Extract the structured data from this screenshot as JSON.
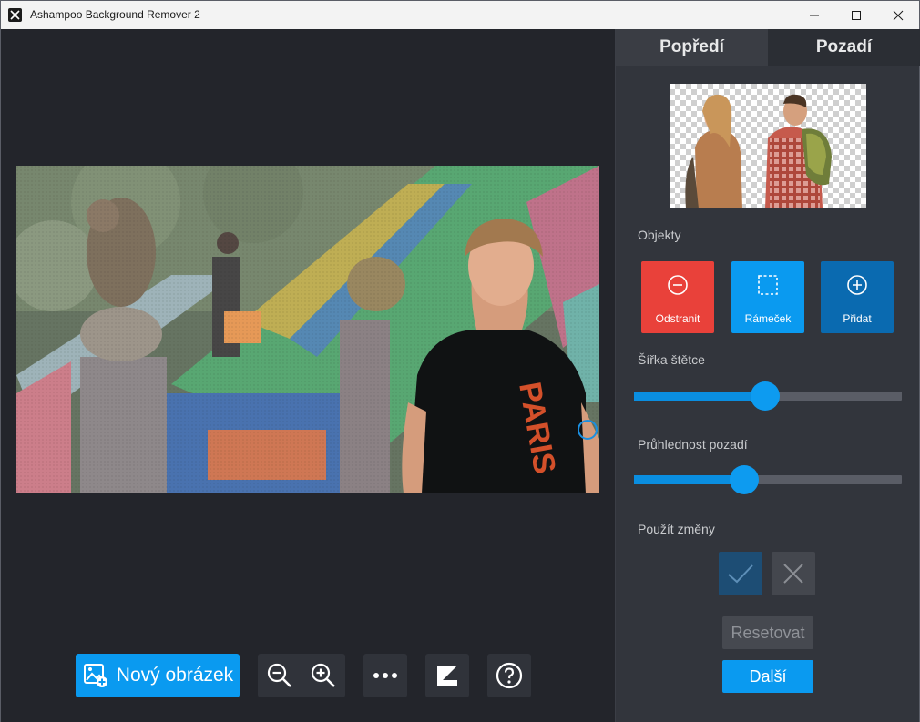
{
  "window": {
    "title": "Ashampoo Background Remover 2"
  },
  "toolbar": {
    "new_image_label": "Nový obrázek"
  },
  "panel": {
    "tabs": [
      {
        "label": "Popředí",
        "active": true
      },
      {
        "label": "Pozadí",
        "active": false
      }
    ],
    "objects_label": "Objekty",
    "object_buttons": [
      {
        "label": "Odstranit",
        "color": "#e9413a"
      },
      {
        "label": "Rámeček",
        "color": "#0a9af0"
      },
      {
        "label": "Přidat",
        "color": "#0a6ab0"
      }
    ],
    "brush_width_label": "Šířka štětce",
    "brush_width_value": 0.49,
    "bg_opacity_label": "Průhlednost pozadí",
    "bg_opacity_value": 0.41,
    "apply_label": "Použít změny",
    "reset_label": "Resetovat",
    "next_label": "Další"
  },
  "colors": {
    "accent": "#0a9af0",
    "remove": "#e9413a",
    "panel_bg": "#32353c",
    "canvas_bg": "#23252b"
  }
}
